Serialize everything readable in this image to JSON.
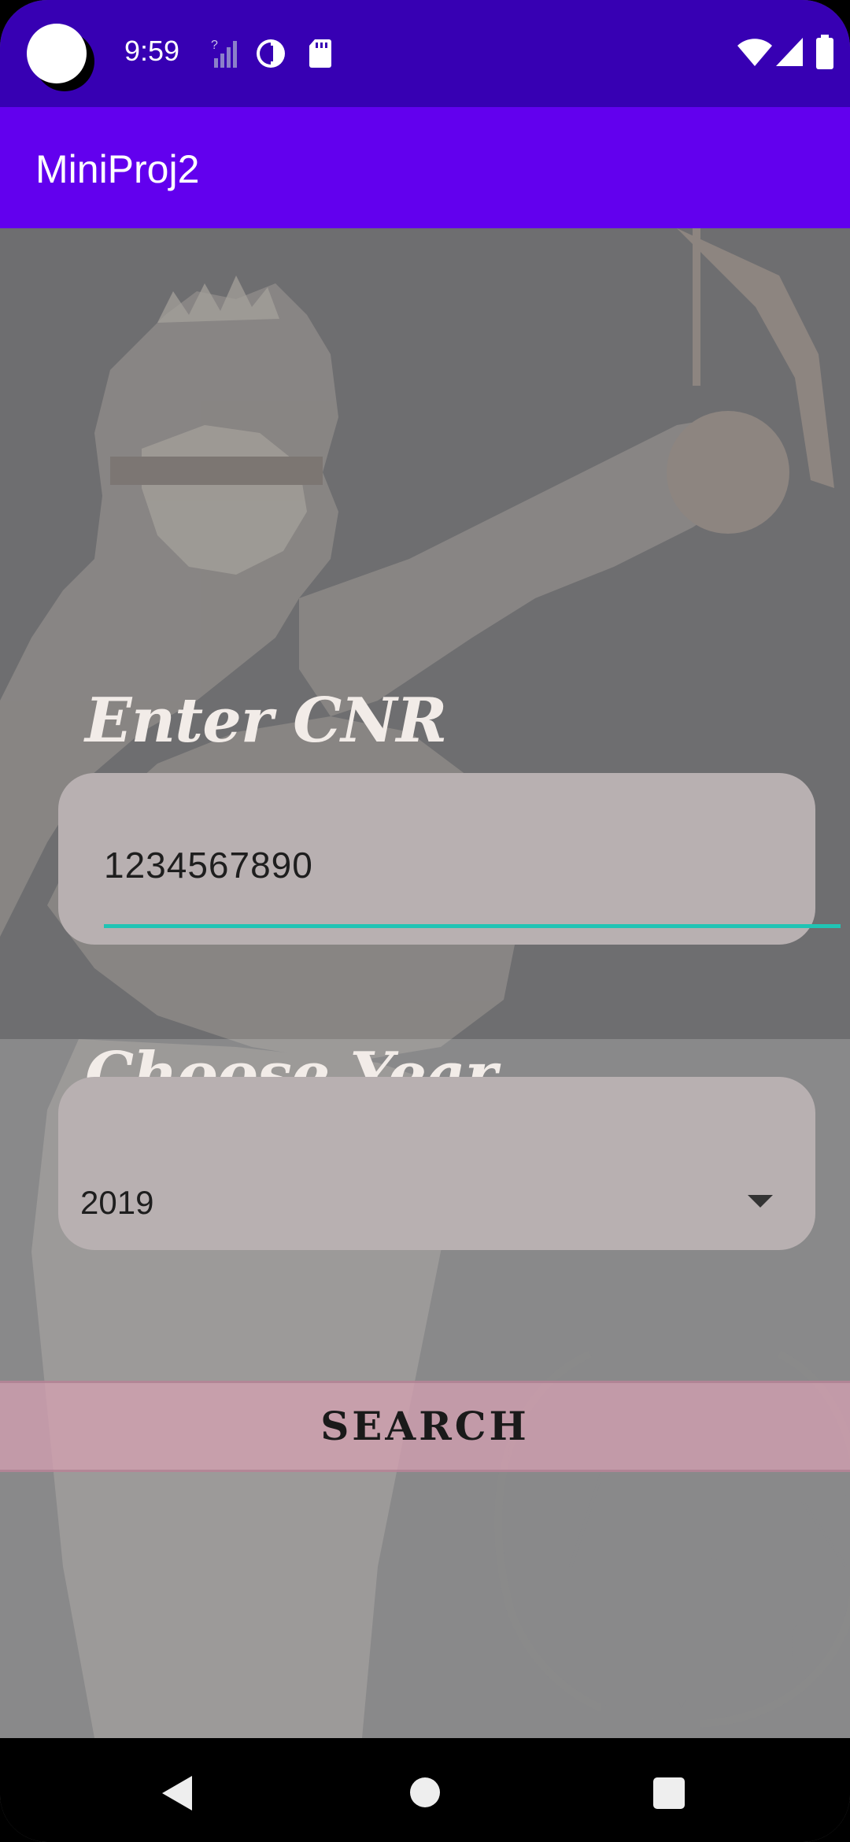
{
  "status_bar": {
    "time": "9:59",
    "icons": [
      "no-sim-signal-icon",
      "data-saver-icon",
      "sd-card-icon",
      "wifi-icon",
      "cell-signal-icon",
      "battery-icon"
    ]
  },
  "app_bar": {
    "title": "MiniProj2"
  },
  "form": {
    "cnr_label": "Enter CNR",
    "cnr_value": "1234567890",
    "year_label": "Choose Year",
    "year_selected": "2019",
    "search_label": "SEARCH"
  },
  "colors": {
    "status_bar": "#3700b3",
    "app_bar": "#6200ee",
    "accent_underline": "#20c4b4",
    "field_background": "#b8b0b1",
    "search_button": "#d6a0b2"
  },
  "nav_bar": {
    "icons": [
      "back-icon",
      "home-icon",
      "recents-icon"
    ]
  }
}
